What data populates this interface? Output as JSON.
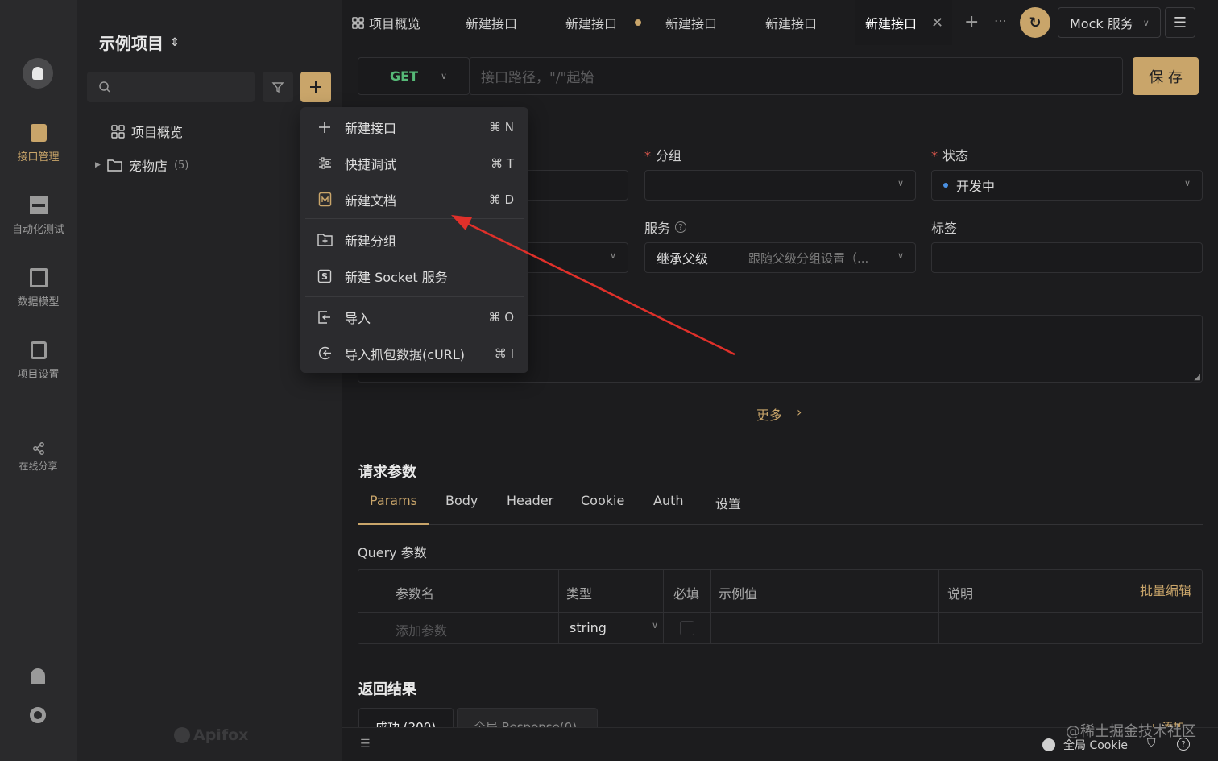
{
  "window": {
    "traffic_colors": [
      "#ec5f57",
      "#f4bf4f",
      "#61c554"
    ]
  },
  "rail": {
    "items": [
      {
        "label": "接口管理",
        "icon": "api-management-icon",
        "active": true
      },
      {
        "label": "自动化测试",
        "icon": "automation-test-icon",
        "active": false
      },
      {
        "label": "数据模型",
        "icon": "data-model-icon",
        "active": false
      },
      {
        "label": "项目设置",
        "icon": "project-settings-icon",
        "active": false
      },
      {
        "label": "在线分享",
        "icon": "share-icon",
        "active": false
      }
    ]
  },
  "project": {
    "title": "示例项目",
    "switch_glyph": "⌃⌄"
  },
  "tree": {
    "overview": "项目概览",
    "folder": {
      "name": "宠物店",
      "count": "(5)"
    },
    "watermark": "Apifox"
  },
  "tabs": [
    {
      "label": "项目概览",
      "has_icon": true,
      "dot": false,
      "active": false
    },
    {
      "label": "新建接口",
      "dot": false,
      "active": false
    },
    {
      "label": "新建接口",
      "dot": true,
      "active": false
    },
    {
      "label": "新建接口",
      "dot": false,
      "active": false
    },
    {
      "label": "新建接口",
      "dot": false,
      "active": false
    },
    {
      "label": "新建接口",
      "dot": false,
      "active": true
    }
  ],
  "topbar": {
    "mock_label": "Mock 服务"
  },
  "request": {
    "method": "GET",
    "path_placeholder": "接口路径，\"/\"起始",
    "save_label": "保 存"
  },
  "fields": {
    "group_label": "分组",
    "status_label": "状态",
    "status_value": "开发中",
    "service_label": "服务",
    "service_value": "继承父级",
    "service_hint": "跟随父级分组设置（...",
    "tag_label": "标签",
    "more_label": "更多"
  },
  "menu": {
    "items": [
      {
        "label": "新建接口",
        "shortcut": "⌘ N",
        "icon": "plus-icon"
      },
      {
        "label": "快捷调试",
        "shortcut": "⌘ T",
        "icon": "quick-debug-icon"
      },
      {
        "label": "新建文档",
        "shortcut": "⌘ D",
        "icon": "markdown-doc-icon"
      },
      {
        "label": "新建分组",
        "shortcut": "",
        "icon": "new-folder-icon"
      },
      {
        "label": "新建 Socket 服务",
        "shortcut": "",
        "icon": "socket-icon"
      },
      {
        "label": "导入",
        "shortcut": "⌘ O",
        "icon": "import-icon"
      },
      {
        "label": "导入抓包数据(cURL)",
        "shortcut": "⌘ I",
        "icon": "curl-import-icon"
      }
    ]
  },
  "params": {
    "section_title": "请求参数",
    "tabs": [
      "Params",
      "Body",
      "Header",
      "Cookie",
      "Auth",
      "设置"
    ],
    "active_tab": "Params",
    "query_title": "Query 参数",
    "bulk_edit": "批量编辑",
    "columns": [
      "参数名",
      "类型",
      "必填",
      "示例值",
      "说明"
    ],
    "row": {
      "name_placeholder": "添加参数",
      "type": "string"
    }
  },
  "response": {
    "title": "返回结果",
    "tabs": [
      "成功 (200)",
      "全局 Response(0)"
    ],
    "add_label": "+ 添加"
  },
  "statusbar": {
    "cookie_label": "全局 Cookie",
    "watermark": "@稀土掘金技术社区"
  },
  "colors": {
    "accent": "#c9a56a",
    "method_green": "#56b977",
    "arrow_red": "#e0302a",
    "status_blue": "#4a90e2"
  }
}
